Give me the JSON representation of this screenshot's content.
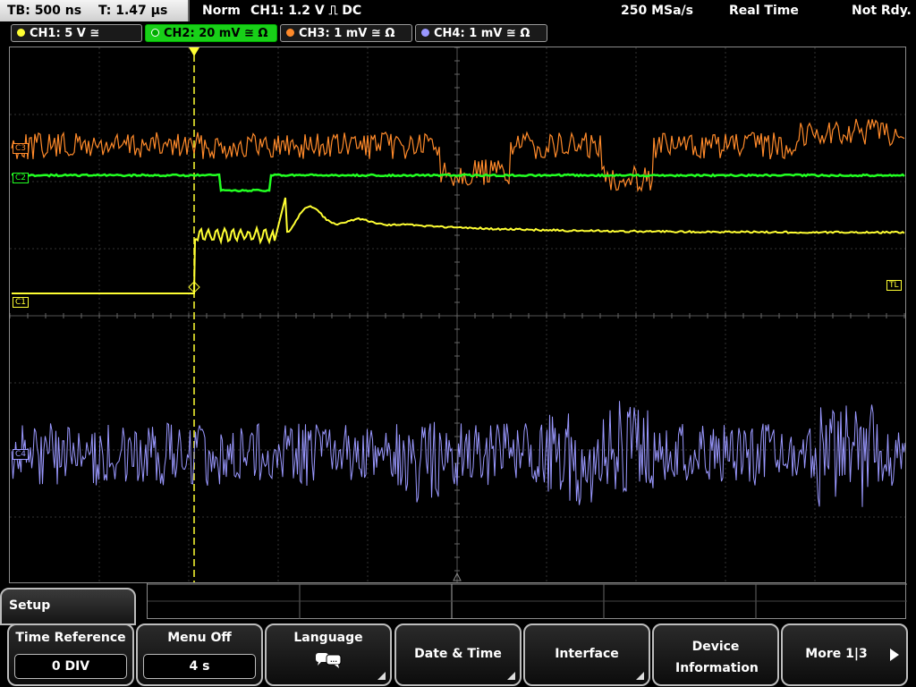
{
  "topbar": {
    "tb": "TB: 500 ns",
    "t": "T: 1.47 µs",
    "mode": "Norm",
    "trigger": "CH1: 1.2 V ⎍ DC",
    "sample_rate": "250 MSa/s",
    "acq": "Real Time",
    "status": "Not Rdy."
  },
  "channels": [
    {
      "label": "CH1: 5 V ≅",
      "color": "#ffff33"
    },
    {
      "label": "CH2: 20 mV ≅ Ω",
      "color": "#22ff22"
    },
    {
      "label": "CH3: 1 mV ≅ Ω",
      "color": "#ff8a2a"
    },
    {
      "label": "CH4: 1 mV ≅ Ω",
      "color": "#9a98ff"
    }
  ],
  "markers": {
    "c1": "C1",
    "c2": "C2",
    "c3": "C3",
    "c4": "C4",
    "tl": "TL"
  },
  "menu": {
    "title": "Setup",
    "keys": [
      {
        "label": "Time Reference",
        "value": "0 DIV"
      },
      {
        "label": "Menu Off",
        "value": "4 s"
      },
      {
        "label": "Language",
        "icon": "speech-bubbles-icon"
      },
      {
        "label": "Date & Time"
      },
      {
        "label": "Interface"
      },
      {
        "label": "Device Information"
      },
      {
        "label": "More 1|3"
      }
    ]
  }
}
